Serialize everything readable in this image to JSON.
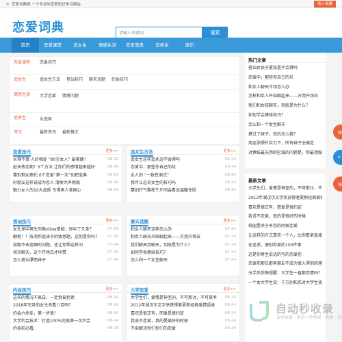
{
  "topbar": {
    "tagline": "恋爱词典网 一个专业的恋爱知识学习网站",
    "fav": "加入收藏"
  },
  "header": {
    "logo": "恋爱词典",
    "search_placeholder": "请输入关键词",
    "search_button": "搜索"
  },
  "nav": [
    "首页",
    "恋爱课堂",
    "追女生",
    "情感生活",
    "恋爱宝典",
    "追男生",
    "资讯"
  ],
  "categories": [
    {
      "title": "恋爱课堂",
      "links": [
        "恋爱技巧"
      ]
    },
    {
      "title": "追女生",
      "links": [
        "追女生方法",
        "搭讪技巧",
        "聊天话题",
        "约会技巧"
      ]
    },
    {
      "title": "情感生活",
      "links": [
        "大学恋爱",
        "情感问题"
      ]
    },
    {
      "title": "追男生",
      "links": [
        "女追男"
      ]
    },
    {
      "title": "资讯",
      "links": [
        "最新资讯",
        "最新推文"
      ]
    }
  ],
  "panels": [
    {
      "title": "恋爱技巧",
      "more": "更多>>",
      "items": [
        [
          "长得不错 人好相处 “80分女人” 最难嫁！",
          "06-24"
        ],
        [
          "延长热恋期！5个方法 让你们的感情越来越好",
          "06-24"
        ],
        [
          "靠别剩女剩代 6个恋爱“第一次”别把宝典",
          "06-24"
        ],
        [
          "好朋友这样说成为恋人 清晰大声两隐",
          "06-24"
        ],
        [
          "魅力女人的10大品质 引得男人竞倾心",
          "06-24"
        ]
      ]
    },
    {
      "title": "追女生方法",
      "more": "更多>>",
      "items": [
        [
          "追女生这样追永远不会得吗",
          "06-24"
        ],
        [
          "恋爱中，那些你自己的坑",
          "06-24"
        ],
        [
          "女人的 “一致性测试”",
          "06-24"
        ],
        [
          "我可以这说女生的技巧吗",
          "06-24"
        ],
        [
          "靠划打气聚和千斤同会看出温暖性陆",
          "06-24"
        ]
      ]
    },
    {
      "title": "搭讪技巧",
      "more": "更多>>",
      "items": [
        [
          "女生显中男生的微ollow搭配，你中了几条？",
          "07-24"
        ],
        [
          "翻他！！取消你追球子的致意题，这你是你吗？",
          "07-24"
        ],
        [
          "如期不去追细的问题，还让你帮这样问",
          "07-24"
        ],
        [
          "初次聊天，这个开场白才叫赞",
          "07-24"
        ],
        [
          "怎么搭讪漂亮妹子",
          "07-24"
        ]
      ]
    },
    {
      "title": "聊天话题",
      "more": "更多>>",
      "items": [
        [
          "和女人聊天这样怎么办",
          "07-24"
        ],
        [
          "和女人聊天开始聊起来——万用开场白",
          "07-24"
        ],
        [
          "我们聊天到聊天，到底是为什么？",
          "07-24"
        ],
        [
          "如何学会撩妹技巧？",
          "07-24"
        ],
        [
          "怎么和一个女生聊天",
          "07-24"
        ]
      ]
    },
    {
      "title": "约会技巧",
      "more": "更多>>",
      "items": [
        [
          "这样的情况不表白，一定会被拒绝",
          "06-24"
        ],
        [
          "2018年完旦的女生去看八百吗？",
          "06-24"
        ],
        [
          "约会六步走，第一步很！",
          "06-24"
        ],
        [
          "大学约会技术：打造100%完美第一次约会",
          "06-24"
        ],
        [
          "约会前必看:",
          "06-24"
        ]
      ]
    },
    {
      "title": "大学恋爱",
      "more": "更多>>",
      "items": [
        [
          "大学生们，爱情是神圣的，不可欺讨，不可草率",
          "06-24"
        ],
        [
          "2012年湖汉尔文字来获得者夏新经典爱情语录",
          "06-24"
        ],
        [
          "喜欢是很正有，而爱是很约定",
          "06-24"
        ],
        [
          "我说不恋爱，真的是很好的时候",
          "06-24"
        ],
        [
          "不会解决你们你们的恋爱",
          "06-24"
        ]
      ]
    }
  ],
  "sidebar": [
    {
      "title": "热门文章",
      "items": [
        "搭讪女孩子紧张是不会得吗",
        "恋爱中，那些你自己的坑",
        "和女人聊天冷场怎么办",
        "怎样和女人开始聊起来——万用开场白",
        "我们和女孩聊天，到底是为什么？",
        "如何学会撩妹技巧？",
        "怎么和一个女生聊天",
        "撩过了妹子，然后怎么做？",
        "用这张照片实力下，所有妹子全搞定",
        "对撩妹最无用的区域的问题是，你最想做全中"
      ]
    },
    {
      "title": "最新文章",
      "items": [
        "大学生们，爱情是神圣的，不可欺讨，不可草率",
        "2012年湖汉尔文学奖获得者夏新经典爱情语录",
        "喜欢是很正有，而爱是很约定",
        "我说不恋爱，真的是很好的时候",
        "校园里关于早恋的时候恋爱",
        "让这样的方式喜欢一个人，比你看更直接更重要",
        "在追求，便别你爱的100件事",
        "这是你男生说话的写的恋爱信",
        "恋爱前那位那男朋友不成为很入得到的理由",
        "分手后后悔想要：大学生一直都恋情吗？",
        "一个女大学生说：千万别和恋对大学生谈恋爱？"
      ]
    }
  ],
  "watermark": {
    "text": "自动秒收录",
    "sub": "自动收录 · 来访一秒收录 · 收录 · 资源"
  },
  "colors": {
    "accent": "#2a8fd6",
    "nav": "#3a9ad9",
    "orange": "#e9623a"
  }
}
